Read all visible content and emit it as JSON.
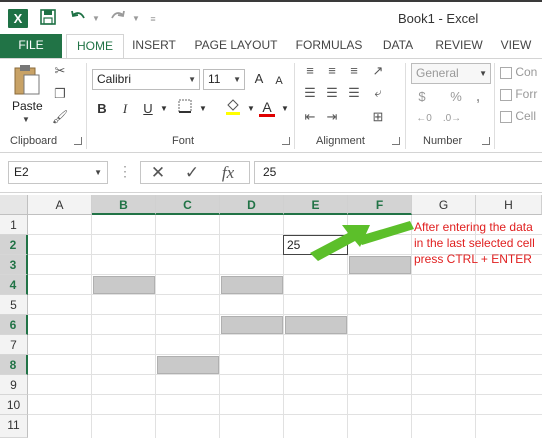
{
  "app": {
    "logo": "X",
    "title": "Book1 - Excel"
  },
  "quick_access": {
    "save_icon": "save-icon",
    "undo_icon": "undo-icon",
    "redo_icon": "redo-icon",
    "customize_icon": "customize-icon"
  },
  "tabs": [
    "FILE",
    "HOME",
    "INSERT",
    "PAGE LAYOUT",
    "FORMULAS",
    "DATA",
    "REVIEW",
    "VIEW"
  ],
  "active_tab": "HOME",
  "ribbon": {
    "clipboard": {
      "paste_label": "Paste",
      "group_label": "Clipboard"
    },
    "font": {
      "font_name": "Calibri",
      "font_size": "11",
      "bold": "B",
      "italic": "I",
      "underline": "U",
      "font_color_letter": "A",
      "grow_font": "A",
      "shrink_font": "A",
      "group_label": "Font"
    },
    "alignment": {
      "group_label": "Alignment"
    },
    "number": {
      "format": "General",
      "percent": "%",
      "comma": ",",
      "group_label": "Number"
    },
    "styles": {
      "items": [
        "Con",
        "Forr",
        "Cell"
      ]
    }
  },
  "formula_bar": {
    "name_box": "E2",
    "cancel": "✕",
    "enter": "✓",
    "fx": "fx",
    "value": "25"
  },
  "sheet": {
    "columns": [
      "A",
      "B",
      "C",
      "D",
      "E",
      "F",
      "G",
      "H"
    ],
    "rows": [
      "1",
      "2",
      "3",
      "4",
      "5",
      "6",
      "7",
      "8",
      "9",
      "10",
      "11"
    ],
    "selected_columns": [
      "B",
      "C",
      "D",
      "E",
      "F"
    ],
    "selected_rows": [
      "2",
      "3",
      "4",
      "6",
      "8"
    ],
    "active_cell": "E2",
    "active_cell_value": "25",
    "annotation": "After entering the data in the last selected cell press CTRL + ENTER",
    "arrow_color": "#5cbf2a",
    "highlight_color": "#c9c9c9",
    "accent_color": "#217346"
  }
}
